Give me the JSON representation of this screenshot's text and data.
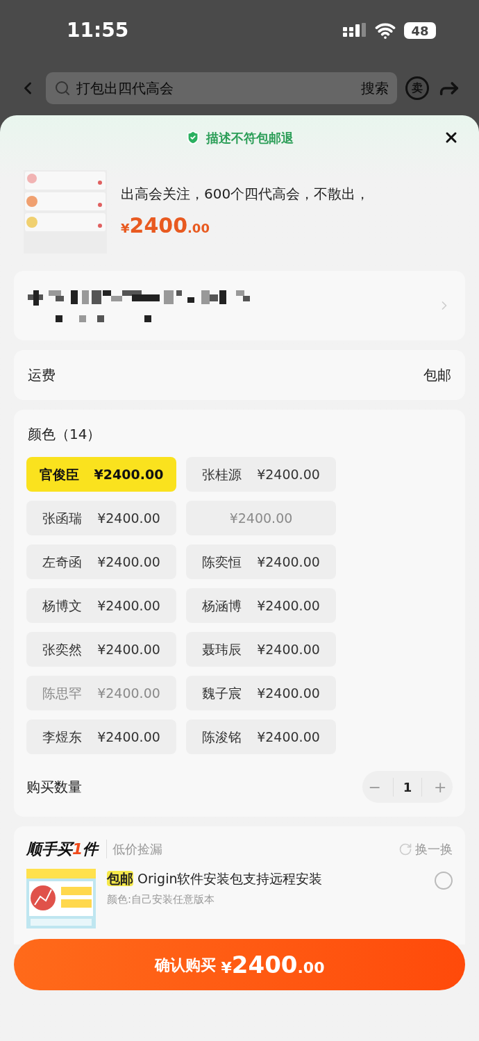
{
  "status_bar": {
    "time": "11:55",
    "battery": "48"
  },
  "search": {
    "placeholder": "打包出四代高会",
    "button": "搜索",
    "sell_char": "卖"
  },
  "sheet": {
    "guarantee": "描述不符包邮退",
    "product": {
      "title": "出高会关注，600个四代高会，不散出，",
      "price_symbol": "¥",
      "price_int": "2400",
      "price_dec": ".00"
    },
    "shipping": {
      "label": "运费",
      "value": "包邮"
    },
    "options": {
      "title": "颜色（14）",
      "items": [
        {
          "name": "官俊臣",
          "price": "¥2400.00",
          "selected": true,
          "disabled": false
        },
        {
          "name": "张桂源",
          "price": "¥2400.00",
          "selected": false,
          "disabled": false
        },
        {
          "name": "张函瑞",
          "price": "¥2400.00",
          "selected": false,
          "disabled": false
        },
        {
          "price": "¥2400.00",
          "selected": false,
          "disabled": true
        },
        {
          "name": "左奇函",
          "price": "¥2400.00",
          "selected": false,
          "disabled": false
        },
        {
          "name": "陈奕恒",
          "price": "¥2400.00",
          "selected": false,
          "disabled": false
        },
        {
          "name": "杨博文",
          "price": "¥2400.00",
          "selected": false,
          "disabled": false
        },
        {
          "name": "杨涵博",
          "price": "¥2400.00",
          "selected": false,
          "disabled": false
        },
        {
          "name": "张奕然",
          "price": "¥2400.00",
          "selected": false,
          "disabled": false
        },
        {
          "name": "聂玮辰",
          "price": "¥2400.00",
          "selected": false,
          "disabled": false
        },
        {
          "name": "陈思罕",
          "price": "¥2400.00",
          "selected": false,
          "disabled": true
        },
        {
          "name": "魏子宸",
          "price": "¥2400.00",
          "selected": false,
          "disabled": false
        },
        {
          "name": "李煜东",
          "price": "¥2400.00",
          "selected": false,
          "disabled": false
        },
        {
          "name": "陈浚铭",
          "price": "¥2400.00",
          "selected": false,
          "disabled": false
        }
      ]
    },
    "quantity": {
      "label": "购买数量",
      "value": "1",
      "minus": "−",
      "plus": "+"
    },
    "addon": {
      "title_a": "顺手买",
      "title_num": "1",
      "title_b": "件",
      "subtitle": "低价捡漏",
      "refresh": "换一换",
      "item": {
        "badge": "包邮",
        "title": "Origin软件安装包支持远程安装",
        "variant": "颜色:自己安装任意版本",
        "selected": false
      }
    },
    "confirm": {
      "label": "确认购买",
      "symbol": "¥",
      "int": "2400",
      "dec": ".00"
    }
  }
}
